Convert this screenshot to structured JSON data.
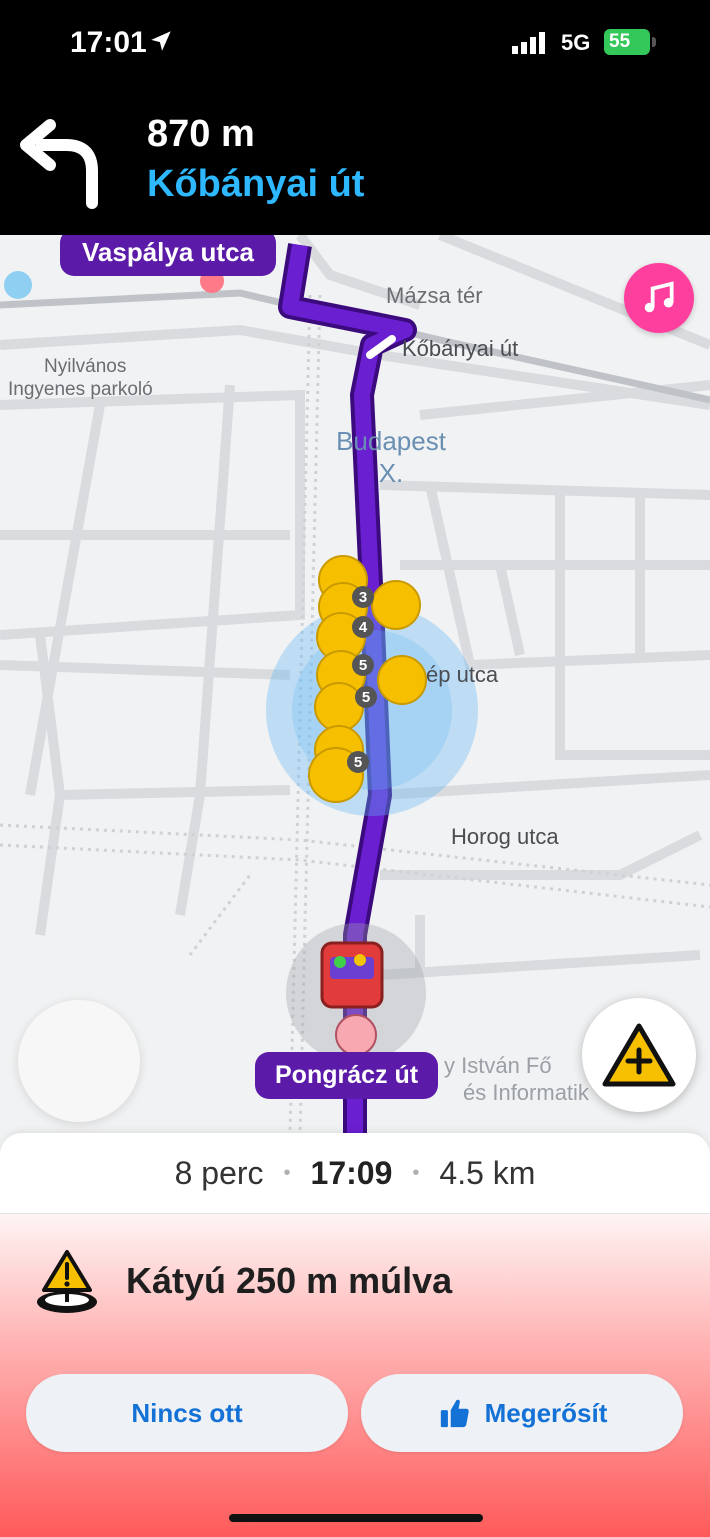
{
  "status": {
    "time": "17:01",
    "network": "5G",
    "battery": "55"
  },
  "nav": {
    "distance": "870 m",
    "street": "Kőbányai út"
  },
  "map": {
    "labels": {
      "vaspalya": "Vaspálya utca",
      "mazsa": "Mázsa tér",
      "kobanyai": "Kőbányai út",
      "parking_line1": "Nyilvános",
      "parking_line2": "Ingyenes parkoló",
      "district_line1": "Budapest",
      "district_line2": "X.",
      "kep_utca": "ép utca",
      "horog_utca": "Horog utca",
      "school_line1": "y István Fő",
      "school_line2": "és Informatik",
      "current_street": "Pongrácz út"
    },
    "hazard_counts": [
      "3",
      "4",
      "5",
      "5",
      "5"
    ]
  },
  "trip": {
    "duration": "8 perc",
    "eta": "17:09",
    "distance": "4.5 km"
  },
  "alert": {
    "message": "Kátyú 250 m múlva",
    "deny_label": "Nincs ott",
    "confirm_label": "Megerősít"
  },
  "colors": {
    "route": "#6a1fd1",
    "accent": "#2eb8ff",
    "hazard": "#f6c000",
    "music": "#ff3f9d"
  },
  "icons": {
    "turn": "turn-left-icon",
    "music": "music-icon",
    "report": "report-hazard-icon",
    "pothole": "pothole-warning-icon",
    "thumb": "thumbs-up-icon"
  }
}
